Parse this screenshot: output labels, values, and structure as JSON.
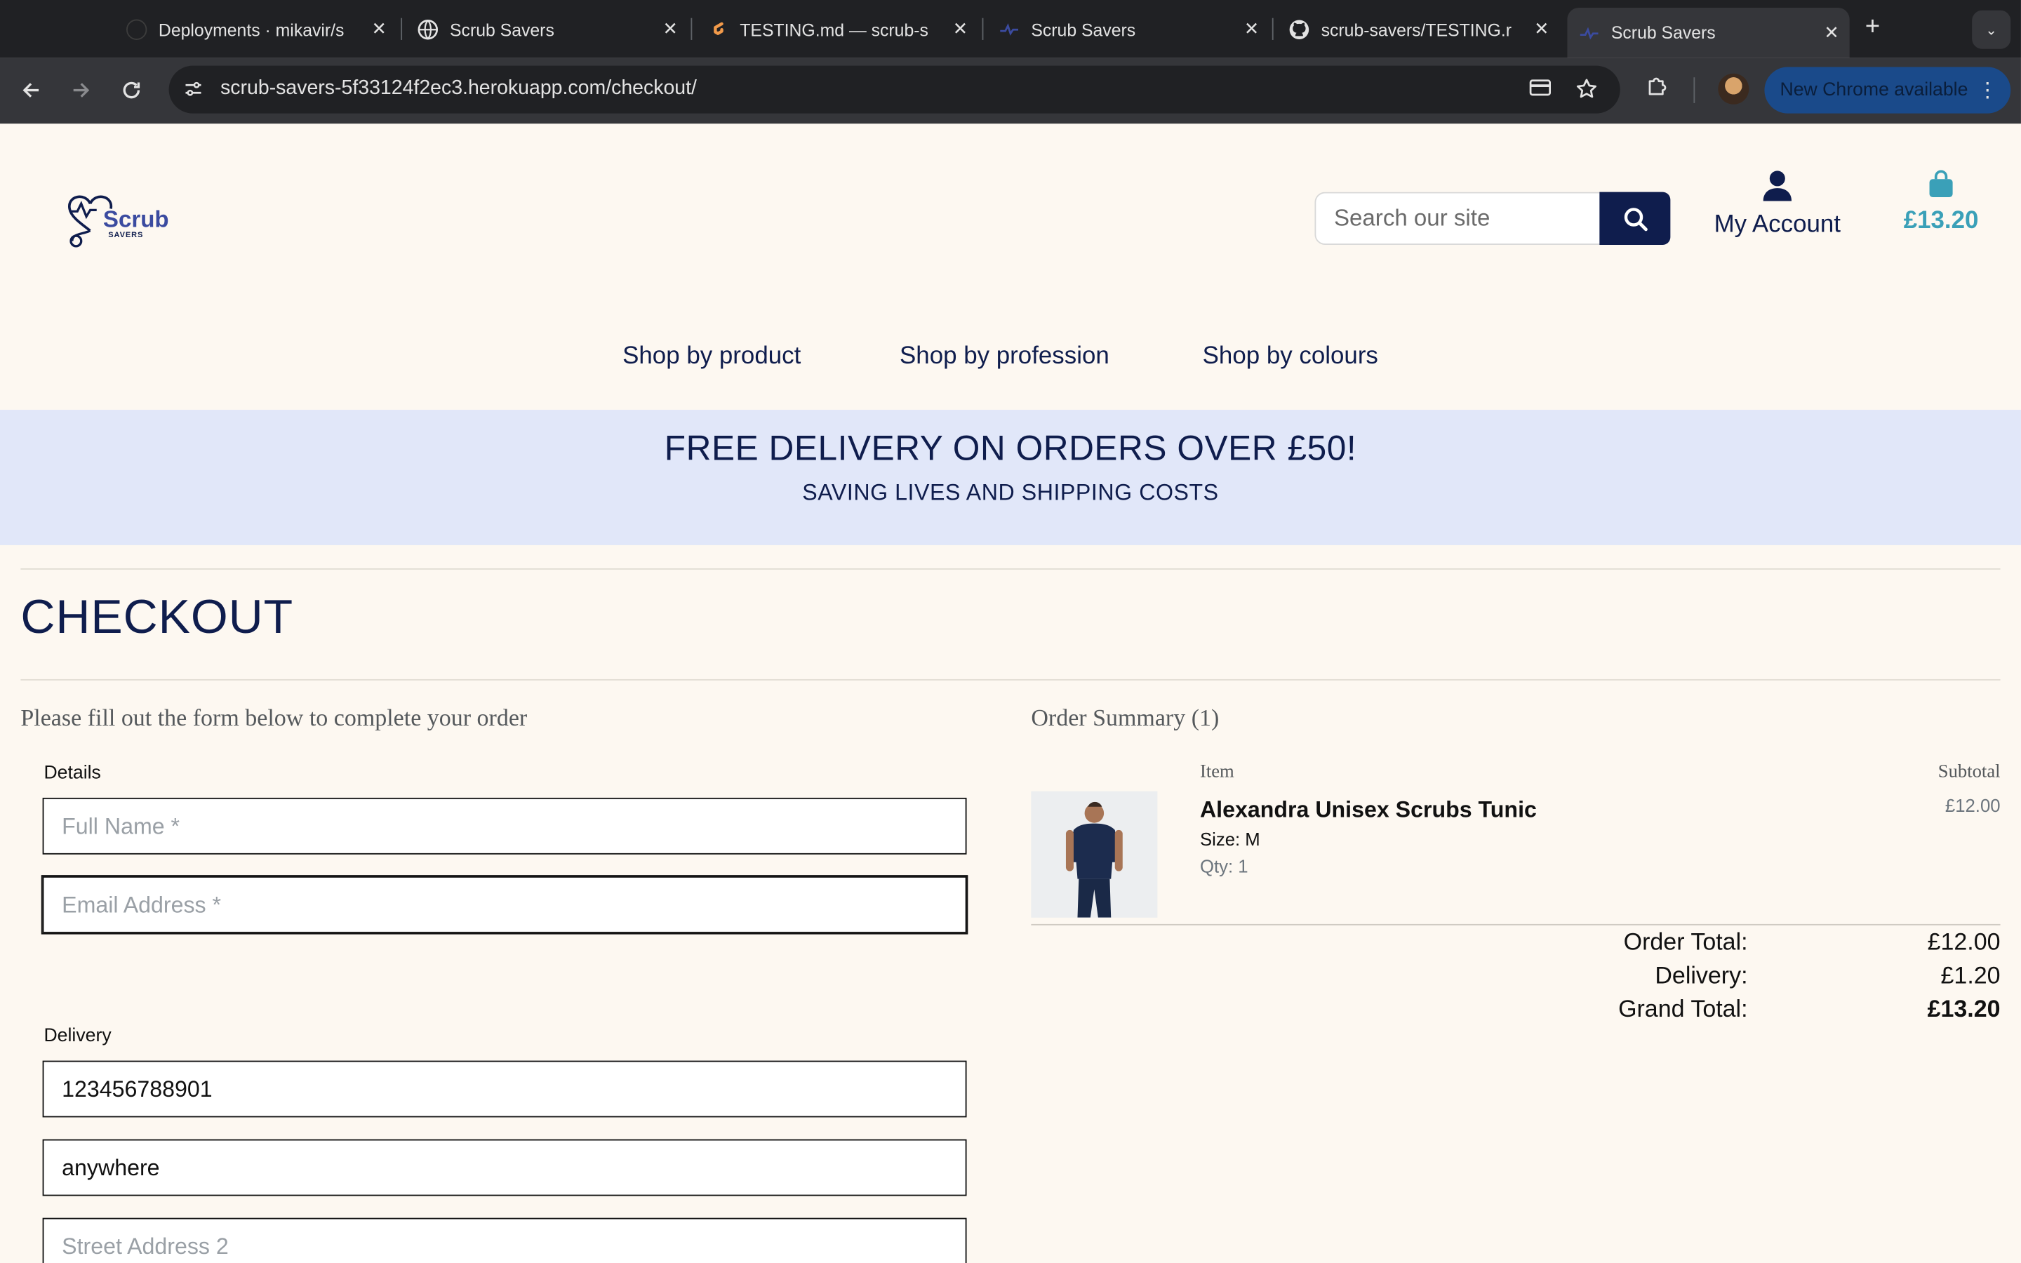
{
  "browser": {
    "tabs": [
      {
        "title": "Deployments · mikavir/s",
        "icon": "github-icon"
      },
      {
        "title": "Scrub Savers",
        "icon": "globe-icon"
      },
      {
        "title": "TESTING.md — scrub-s",
        "icon": "gitpod-icon"
      },
      {
        "title": "Scrub Savers",
        "icon": "scrub-savers-favicon"
      },
      {
        "title": "scrub-savers/TESTING.r",
        "icon": "github-icon"
      },
      {
        "title": "Scrub Savers",
        "icon": "scrub-savers-favicon"
      }
    ],
    "active_tab": 5,
    "url": "scrub-savers-5f33124f2ec3.herokuapp.com/checkout/",
    "update_label": "New Chrome available"
  },
  "header": {
    "logo_text": "Scrub",
    "logo_subtext": "SAVERS",
    "search_placeholder": "Search our site",
    "account_label": "My Account",
    "bag_total": "£13.20"
  },
  "nav": {
    "items": [
      "Shop by product",
      "Shop by profession",
      "Shop by colours"
    ]
  },
  "banner": {
    "headline": "FREE DELIVERY ON ORDERS OVER £50!",
    "subline": "SAVING LIVES AND SHIPPING COSTS"
  },
  "checkout": {
    "title": "CHECKOUT",
    "intro": "Please fill out the form below to complete your order",
    "details_label": "Details",
    "full_name_placeholder": "Full Name *",
    "email_placeholder": "Email Address *",
    "delivery_label": "Delivery",
    "phone_value": "123456788901",
    "address1_value": "anywhere",
    "address2_placeholder": "Street Address 2"
  },
  "summary": {
    "title": "Order Summary (1)",
    "col_item": "Item",
    "col_subtotal": "Subtotal",
    "product": {
      "name": "Alexandra Unisex Scrubs Tunic",
      "size": "Size: M",
      "qty": "Qty: 1",
      "subtotal": "£12.00"
    },
    "order_total_label": "Order Total:",
    "order_total": "£12.00",
    "delivery_label": "Delivery:",
    "delivery": "£1.20",
    "grand_total_label": "Grand Total:",
    "grand_total": "£13.20"
  }
}
